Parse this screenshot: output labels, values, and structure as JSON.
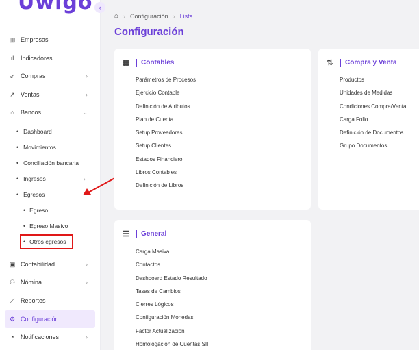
{
  "app": {
    "logo": "Uwigo",
    "collapse_icon": "chevron-left-icon"
  },
  "sidebar": {
    "items": [
      {
        "icon": "building-icon",
        "glyph": "▥",
        "label": "Empresas",
        "chevron": false
      },
      {
        "icon": "bar-chart-icon",
        "glyph": "ıl",
        "label": "Indicadores",
        "chevron": false
      },
      {
        "icon": "arrow-down-left-icon",
        "glyph": "↙",
        "label": "Compras",
        "chevron": true
      },
      {
        "icon": "arrow-up-right-icon",
        "glyph": "↗",
        "label": "Ventas",
        "chevron": true
      },
      {
        "icon": "bank-icon",
        "glyph": "🏛",
        "label": "Bancos",
        "chevron": true,
        "expanded": true
      }
    ],
    "bancos_sub": [
      {
        "label": "Dashboard",
        "chevron": false
      },
      {
        "label": "Movimientos",
        "chevron": false
      },
      {
        "label": "Conciliación bancaria",
        "chevron": false
      },
      {
        "label": "Ingresos",
        "chevron": true
      },
      {
        "label": "Egresos",
        "chevron": true,
        "expanded": true
      }
    ],
    "egresos_sub": [
      {
        "label": "Egreso"
      },
      {
        "label": "Egreso Masivo"
      },
      {
        "label": "Otros egresos"
      }
    ],
    "bottom_items": [
      {
        "icon": "calculator-icon",
        "glyph": "▣",
        "label": "Contabilidad",
        "chevron": true
      },
      {
        "icon": "users-icon",
        "glyph": "⚇",
        "label": "Nómina",
        "chevron": true
      },
      {
        "icon": "line-chart-icon",
        "glyph": "⟋",
        "label": "Reportes",
        "chevron": false
      },
      {
        "icon": "gear-icon",
        "glyph": "⚙",
        "label": "Configuración",
        "chevron": false,
        "active": true
      },
      {
        "icon": "bell-icon",
        "glyph": "♫",
        "label": "Notificaciones",
        "chevron": true
      }
    ]
  },
  "breadcrumb": {
    "home_icon": "home-icon",
    "section": "Configuración",
    "current": "Lista"
  },
  "page_title": "Configuración",
  "cards": {
    "contables": {
      "icon": "calculator-icon",
      "title": "Contables",
      "items": [
        "Parámetros de Procesos",
        "Ejercicio Contable",
        "Definición de Atributos",
        "Plan de Cuenta",
        "Setup Proveedores",
        "Setup Clientes",
        "Estados Financiero",
        "Libros Contables",
        "Definición de Libros"
      ]
    },
    "compra_venta": {
      "icon": "swap-vertical-icon",
      "title": "Compra y Venta",
      "items": [
        "Productos",
        "Unidades de Medidas",
        "Condiciones Compra/Venta",
        "Carga Folio",
        "Definición de Documentos",
        "Grupo Documentos"
      ]
    },
    "general": {
      "icon": "list-settings-icon",
      "title": "General",
      "items": [
        "Carga Masiva",
        "Contactos",
        "Dashboard Estado Resultado",
        "Tasas de Cambios",
        "Cierres Lógicos",
        "Configuración Monedas",
        "Factor Actualización",
        "Homologación de Cuentas SII"
      ]
    }
  },
  "colors": {
    "accent": "#6b3fd8",
    "annotation": "#e01818",
    "active_bg": "#f0e9fd"
  }
}
